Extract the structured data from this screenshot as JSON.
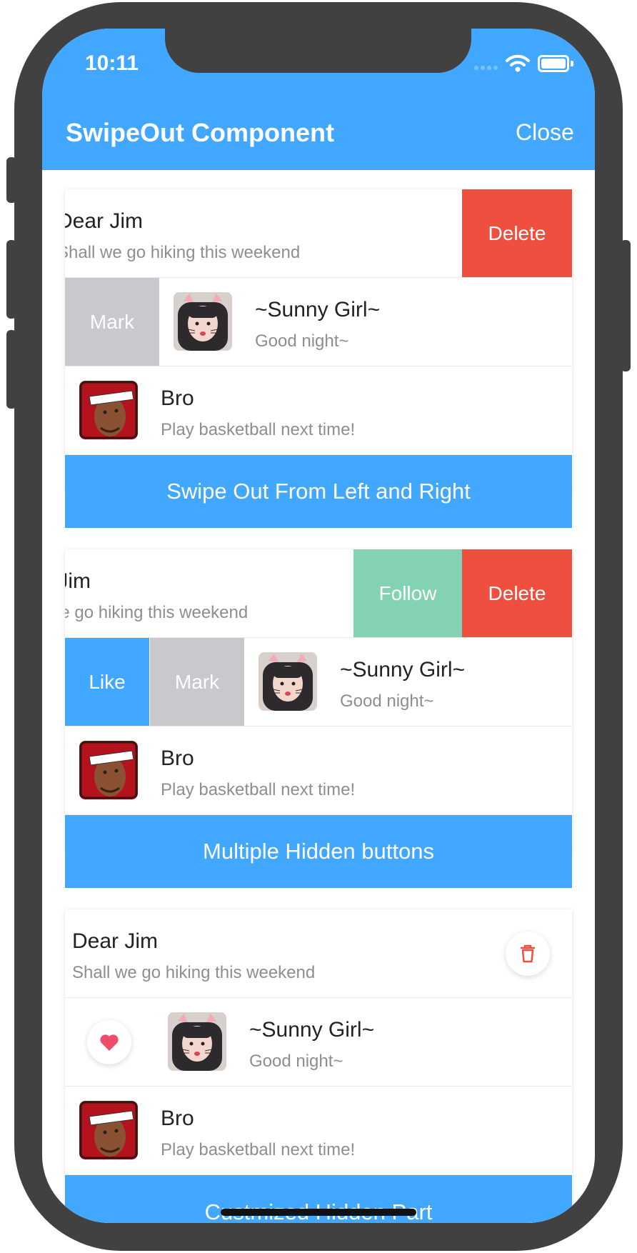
{
  "status_bar": {
    "time": "10:11"
  },
  "nav": {
    "title": "SwipeOut Component",
    "close_label": "Close"
  },
  "contacts": {
    "jim": {
      "name": "Dear Jim",
      "message": "Shall we go hiking this weekend"
    },
    "sunny": {
      "name": "~Sunny Girl~",
      "message": "Good night~"
    },
    "bro": {
      "name": "Bro",
      "message": "Play basketball next time!"
    }
  },
  "actions": {
    "delete": "Delete",
    "mark": "Mark",
    "follow": "Follow",
    "like": "Like"
  },
  "cards": [
    {
      "button": "Swipe Out From Left and Right"
    },
    {
      "button": "Multiple Hidden buttons"
    },
    {
      "button": "Custmized Hidden Part"
    }
  ],
  "colors": {
    "primary": "#42a7ff",
    "delete": "#ef4f3f",
    "mark": "#c8c8cd",
    "follow": "#82d2b3",
    "heart": "#ee4d6a"
  },
  "icons": {
    "trash": "trash-icon",
    "heart": "heart-icon",
    "wifi": "wifi-icon",
    "battery": "battery-icon"
  }
}
